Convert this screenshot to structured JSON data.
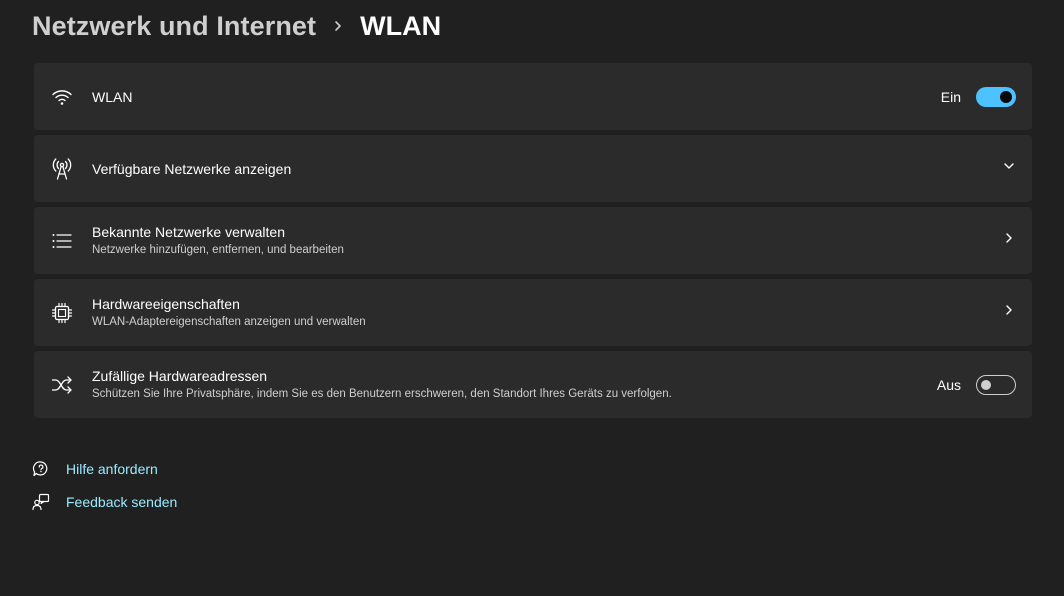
{
  "breadcrumb": {
    "parent": "Netzwerk und Internet",
    "current": "WLAN",
    "separator_icon": "chevron-right-icon"
  },
  "cards": {
    "wlan": {
      "icon": "wifi-icon",
      "title": "WLAN",
      "state_label": "Ein",
      "toggle_on": true
    },
    "available": {
      "icon": "antenna-icon",
      "title": "Verfügbare Netzwerke anzeigen",
      "trailing_icon": "chevron-down-icon"
    },
    "known": {
      "icon": "list-icon",
      "title": "Bekannte Netzwerke verwalten",
      "subtitle": "Netzwerke hinzufügen, entfernen, und bearbeiten",
      "trailing_icon": "chevron-right-icon"
    },
    "hardware": {
      "icon": "chip-icon",
      "title": "Hardwareeigenschaften",
      "subtitle": "WLAN-Adaptereigenschaften anzeigen und verwalten",
      "trailing_icon": "chevron-right-icon"
    },
    "random_mac": {
      "icon": "shuffle-icon",
      "title": "Zufällige Hardwareadressen",
      "subtitle": "Schützen Sie Ihre Privatsphäre, indem Sie es den Benutzern erschweren, den Standort Ihres Geräts zu verfolgen.",
      "state_label": "Aus",
      "toggle_on": false
    }
  },
  "links": {
    "help": {
      "icon": "help-chat-icon",
      "label": "Hilfe anfordern"
    },
    "feedback": {
      "icon": "feedback-icon",
      "label": "Feedback senden"
    }
  },
  "colors": {
    "background": "#202020",
    "card": "#2b2b2b",
    "accent": "#4cc2ff",
    "link": "#99ebff"
  }
}
